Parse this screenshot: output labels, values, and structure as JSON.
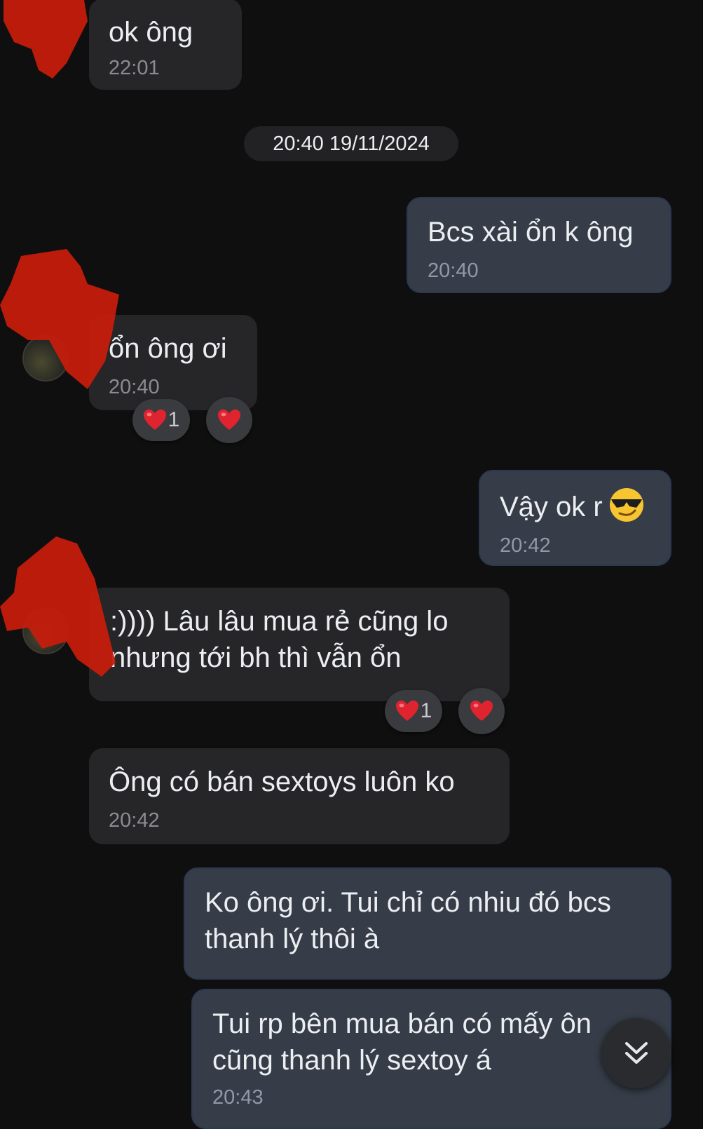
{
  "date_separator": "20:40 19/11/2024",
  "messages": [
    {
      "id": "m1",
      "direction": "incoming",
      "text": "ok ông",
      "time": "22:01"
    },
    {
      "id": "m2",
      "direction": "outgoing",
      "text": "Bcs xài ổn k ông",
      "time": "20:40"
    },
    {
      "id": "m3",
      "direction": "incoming",
      "text": "ổn ông ơi",
      "time": "20:40",
      "reaction_count": "1"
    },
    {
      "id": "m4",
      "direction": "outgoing",
      "text": "Vậy ok r",
      "time": "20:42",
      "emoji": "smiling-face-with-sunglasses"
    },
    {
      "id": "m5",
      "direction": "incoming",
      "text": ":)))) Lâu lâu mua rẻ cũng lo\nnhưng tới bh thì vẫn ổn",
      "reaction_count": "1"
    },
    {
      "id": "m6",
      "direction": "incoming",
      "text": "Ông có bán sextoys luôn ko",
      "time": "20:42"
    },
    {
      "id": "m7",
      "direction": "outgoing",
      "text": "Ko ông ơi. Tui chỉ có nhiu đó bcs\nthanh lý thôi à"
    },
    {
      "id": "m8",
      "direction": "outgoing",
      "text": "Tui rp bên mua bán có mấy ôn\ncũng thanh lý sextoy á",
      "time": "20:43"
    }
  ],
  "colors": {
    "background": "#0f0f10",
    "incoming_bubble": "#262628",
    "outgoing_bubble": "#363d48",
    "heart": "#e0242f",
    "redaction": "#c41c0c"
  },
  "icons": {
    "reaction": "heart-icon",
    "scroll": "double-chevron-down-icon"
  }
}
